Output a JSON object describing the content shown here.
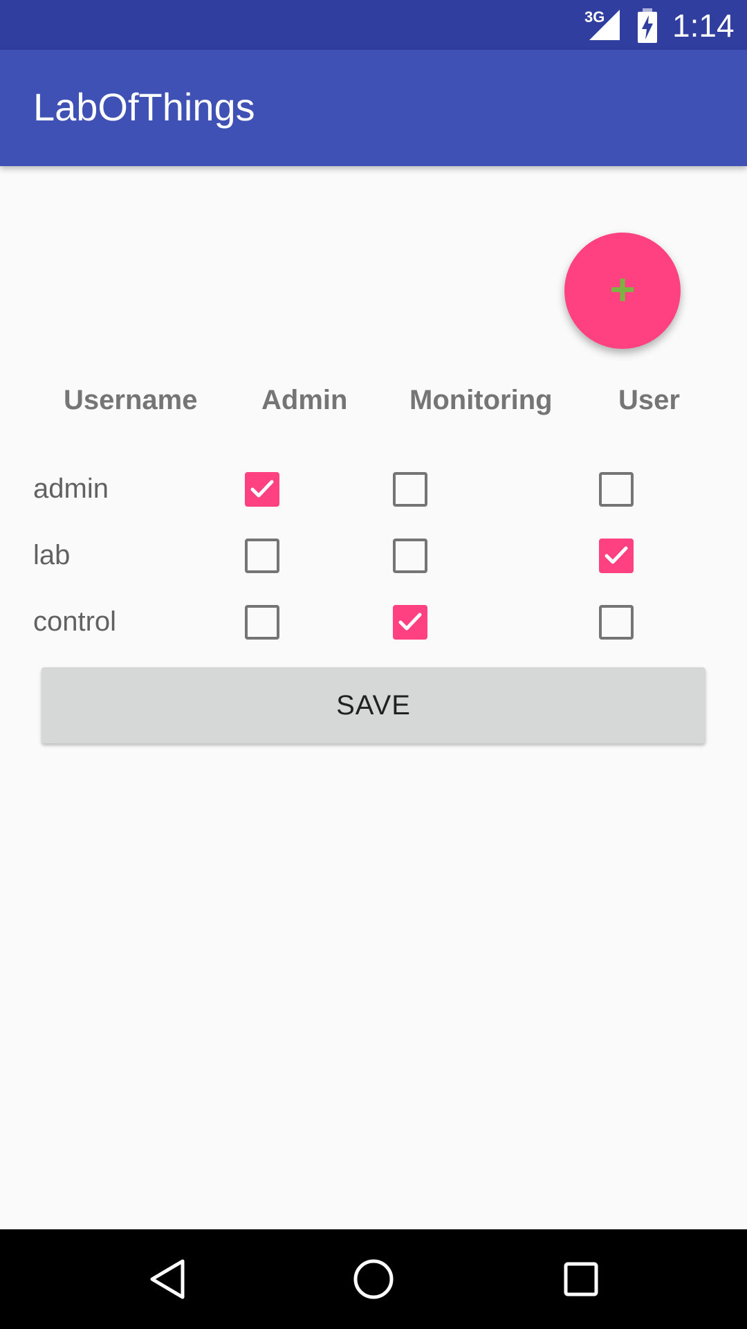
{
  "status_bar": {
    "network": "3G",
    "time": "1:14"
  },
  "app_bar": {
    "title": "LabOfThings"
  },
  "fab": {
    "label": "+",
    "icon": "add-icon",
    "color": "#ff4081",
    "icon_color": "#7cb342"
  },
  "table": {
    "headers": [
      "Username",
      "Admin",
      "Monitoring",
      "User"
    ],
    "rows": [
      {
        "username": "admin",
        "admin": true,
        "monitoring": false,
        "user": false
      },
      {
        "username": "lab",
        "admin": false,
        "monitoring": false,
        "user": true
      },
      {
        "username": "control",
        "admin": false,
        "monitoring": true,
        "user": false
      }
    ]
  },
  "save_button": {
    "label": "SAVE"
  },
  "colors": {
    "primary": "#3f51b5",
    "primary_dark": "#303f9f",
    "accent": "#ff4081"
  },
  "nav_bar": {
    "icons": [
      "back-icon",
      "home-icon",
      "recents-icon"
    ]
  }
}
